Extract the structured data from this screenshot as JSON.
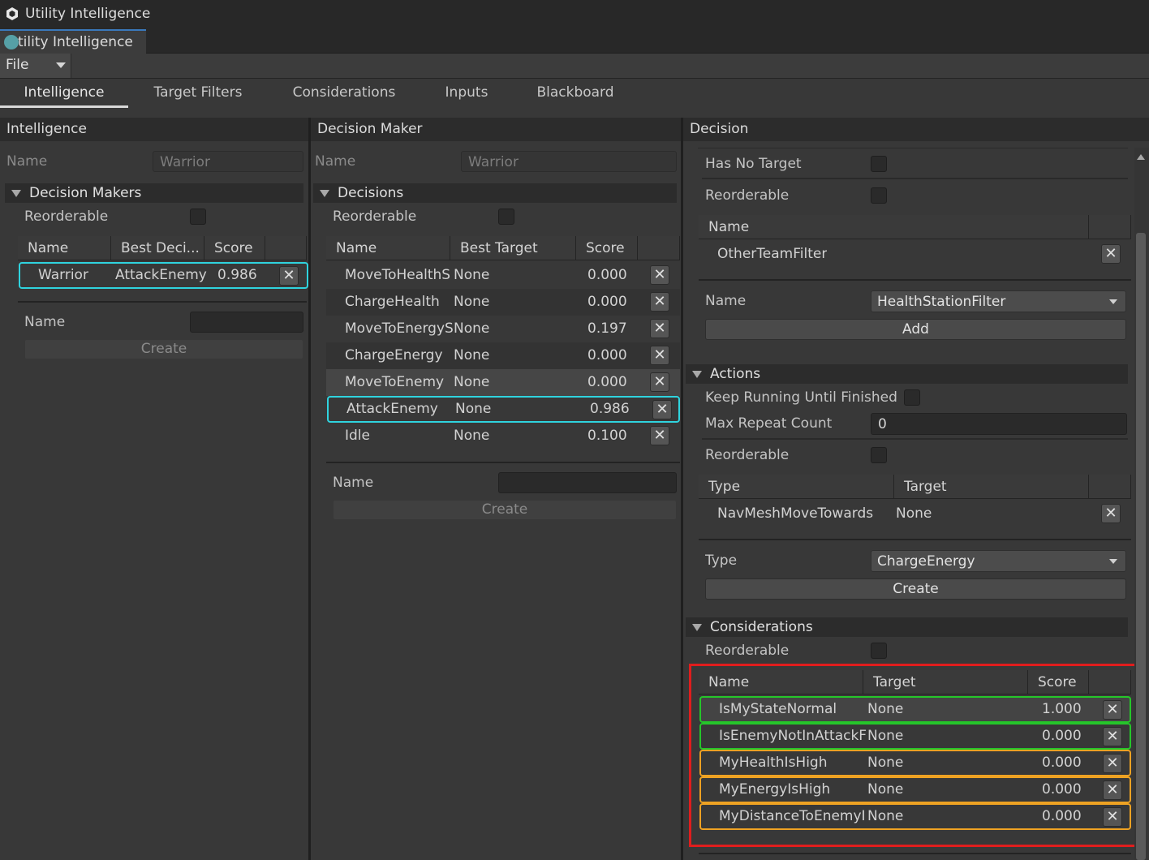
{
  "window": {
    "title": "Utility Intelligence",
    "tab_label": "tility Intelligence"
  },
  "menu": {
    "file": "File"
  },
  "tabs": [
    "Intelligence",
    "Target Filters",
    "Considerations",
    "Inputs",
    "Blackboard"
  ],
  "intelligence_panel": {
    "header": "Intelligence",
    "name_label": "Name",
    "name_value": "Warrior",
    "foldout": "Decision Makers",
    "reorderable_label": "Reorderable",
    "columns": [
      "Name",
      "Best Deci...",
      "Score"
    ],
    "rows": [
      {
        "name": "Warrior",
        "best": "AttackEnemy",
        "score": "0.986"
      }
    ],
    "new_name_label": "Name",
    "create_label": "Create"
  },
  "decision_maker_panel": {
    "header": "Decision Maker",
    "name_label": "Name",
    "name_value": "Warrior",
    "foldout": "Decisions",
    "reorderable_label": "Reorderable",
    "columns": [
      "Name",
      "Best Target",
      "Score"
    ],
    "rows": [
      {
        "name": "MoveToHealthS",
        "target": "None",
        "score": "0.000"
      },
      {
        "name": "ChargeHealth",
        "target": "None",
        "score": "0.000"
      },
      {
        "name": "MoveToEnergyS",
        "target": "None",
        "score": "0.197"
      },
      {
        "name": "ChargeEnergy",
        "target": "None",
        "score": "0.000"
      },
      {
        "name": "MoveToEnemy",
        "target": "None",
        "score": "0.000"
      },
      {
        "name": "AttackEnemy",
        "target": "None",
        "score": "0.986"
      },
      {
        "name": "Idle",
        "target": "None",
        "score": "0.100"
      }
    ],
    "new_name_label": "Name",
    "create_label": "Create"
  },
  "decision_panel": {
    "header": "Decision",
    "has_no_target_label": "Has No Target",
    "reorderable_label": "Reorderable",
    "filters_column": "Name",
    "filters": [
      "OtherTeamFilter"
    ],
    "filter_name_label": "Name",
    "filter_dropdown": "HealthStationFilter",
    "add_label": "Add",
    "actions": {
      "foldout": "Actions",
      "keep_running_label": "Keep Running Until Finished",
      "max_repeat_label": "Max Repeat Count",
      "max_repeat_value": "0",
      "reorderable_label": "Reorderable",
      "columns": [
        "Type",
        "Target"
      ],
      "rows": [
        {
          "type": "NavMeshMoveTowards",
          "target": "None"
        }
      ],
      "type_label": "Type",
      "type_dropdown": "ChargeEnergy",
      "create_label": "Create"
    },
    "considerations": {
      "foldout": "Considerations",
      "reorderable_label": "Reorderable",
      "columns": [
        "Name",
        "Target",
        "Score"
      ],
      "rows": [
        {
          "name": "IsMyStateNormal",
          "target": "None",
          "score": "1.000",
          "highlight": "green"
        },
        {
          "name": "IsEnemyNotInAttackF",
          "target": "None",
          "score": "0.000",
          "highlight": "green"
        },
        {
          "name": "MyHealthIsHigh",
          "target": "None",
          "score": "0.000",
          "highlight": "orange"
        },
        {
          "name": "MyEnergyIsHigh",
          "target": "None",
          "score": "0.000",
          "highlight": "orange"
        },
        {
          "name": "MyDistanceToEnemyI",
          "target": "None",
          "score": "0.000",
          "highlight": "orange"
        }
      ]
    }
  },
  "colors": {
    "selection": "#2fd3de",
    "annotation_red": "#e01d1d",
    "annotation_green": "#25c62a",
    "annotation_orange": "#eea223"
  }
}
